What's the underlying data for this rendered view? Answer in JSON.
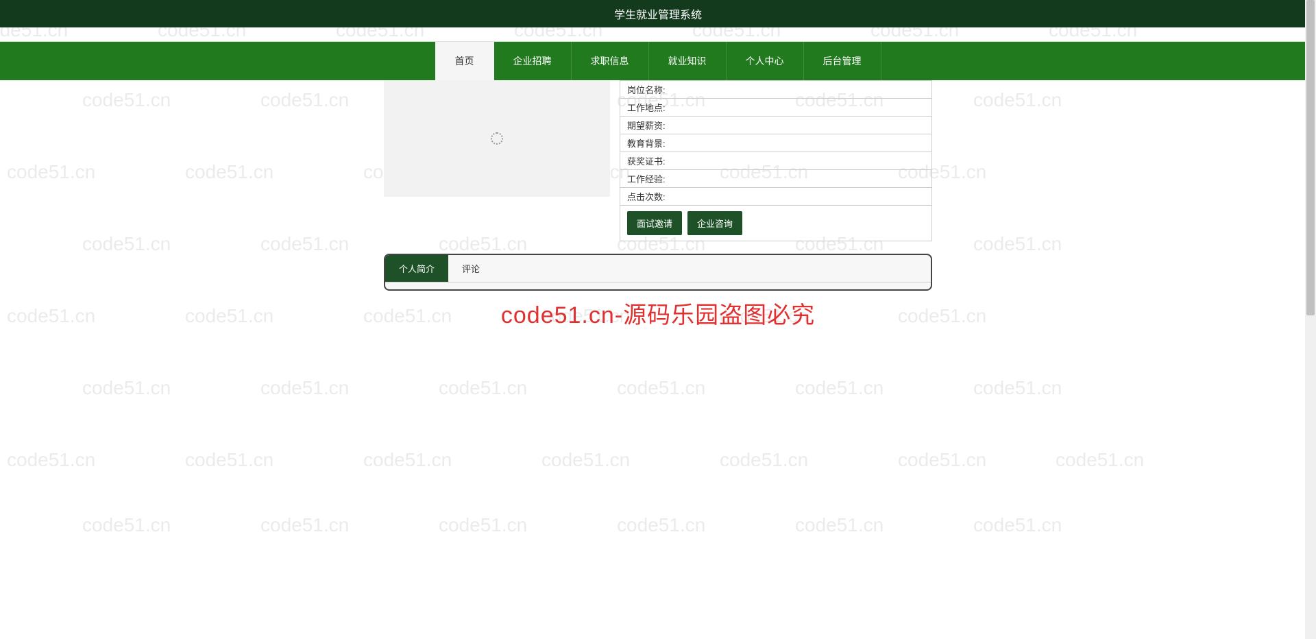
{
  "header": {
    "title": "学生就业管理系统"
  },
  "nav": {
    "items": [
      {
        "label": "首页",
        "active": true
      },
      {
        "label": "企业招聘",
        "active": false
      },
      {
        "label": "求职信息",
        "active": false
      },
      {
        "label": "就业知识",
        "active": false
      },
      {
        "label": "个人中心",
        "active": false
      },
      {
        "label": "后台管理",
        "active": false
      }
    ]
  },
  "detail": {
    "fields": [
      {
        "label": "岗位名称:"
      },
      {
        "label": "工作地点:"
      },
      {
        "label": "期望薪资:"
      },
      {
        "label": "教育背景:"
      },
      {
        "label": "获奖证书:"
      },
      {
        "label": "工作经验:"
      },
      {
        "label": "点击次数:"
      }
    ],
    "buttons": {
      "interview": "面试邀请",
      "consult": "企业咨询"
    }
  },
  "tabs": {
    "items": [
      {
        "label": "个人简介",
        "active": true
      },
      {
        "label": "评论",
        "active": false
      }
    ]
  },
  "watermark": {
    "text": "code51.cn",
    "big_text": "code51.cn-源码乐园盗图必究"
  }
}
